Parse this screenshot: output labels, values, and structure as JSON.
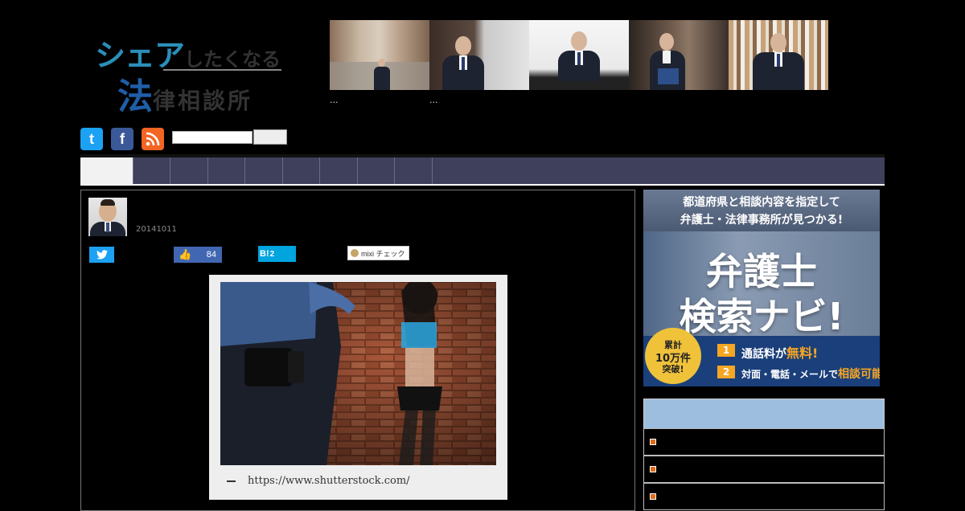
{
  "logo": {
    "line1_big": "シェア",
    "line1_small": "したくなる",
    "line2_big": "法",
    "line2_small": "律相談所"
  },
  "header_photos": {
    "captions": [
      "...",
      "..."
    ]
  },
  "social": {
    "twitter_glyph": "t",
    "facebook_glyph": "f"
  },
  "article": {
    "date": "20141011",
    "share_buttons": {
      "like_count": "84",
      "hatena_label": "B!",
      "hatena_count": "2",
      "mixi_label": "mixi チェック"
    },
    "figure_caption": "https://www.shutterstock.com/"
  },
  "sidebar_ad": {
    "headline_line1": "都道府県と相談内容を指定して",
    "headline_line2": "弁護士・法律事務所が見つかる!",
    "title_line1": "弁護士",
    "title_line2": "検索ナビ!",
    "badge_line1": "累計",
    "badge_line2": "10万件",
    "badge_line3": "突破!",
    "point1_num": "1",
    "point1_text_pre": "通話料が",
    "point1_text_em": "無料!",
    "point2_num": "2",
    "point2_text_pre": "対面・電話・メールで",
    "point2_text_em": "相談可能!"
  },
  "colors": {
    "nav_bg": "#3e405c",
    "twitter": "#1da1f2",
    "facebook": "#3b5998",
    "rss": "#f26522",
    "sidebar_header": "#9dbedf",
    "ad_accent": "#f5a623"
  }
}
